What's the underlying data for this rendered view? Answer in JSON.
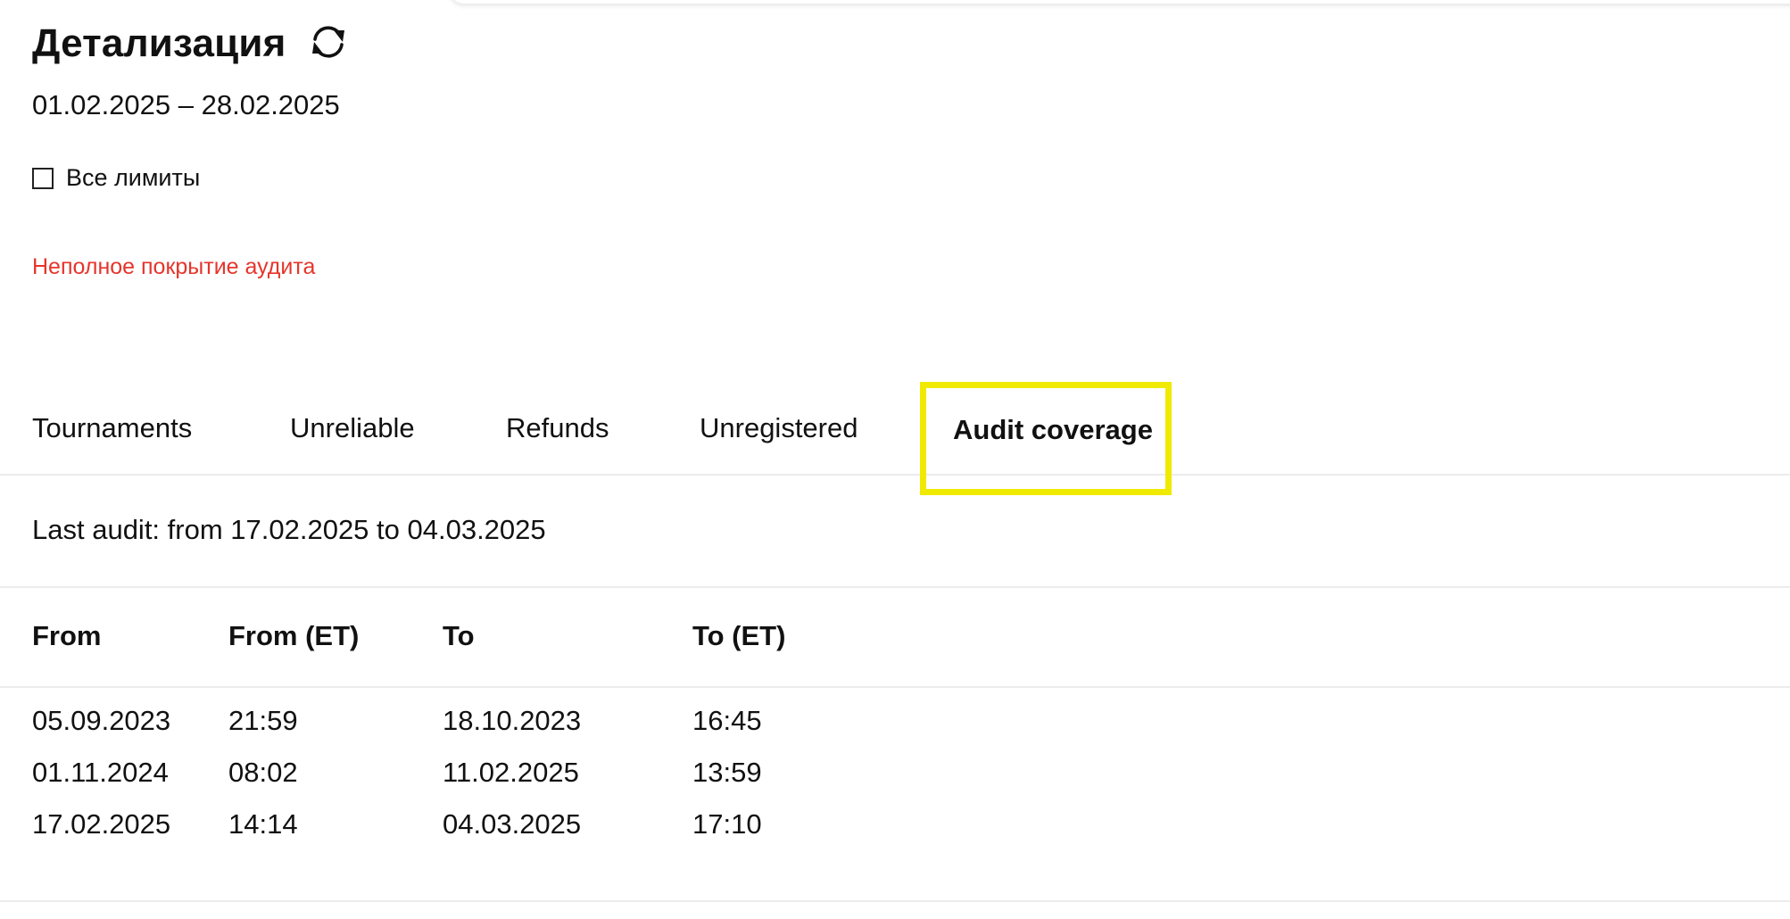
{
  "header": {
    "title": "Детализация",
    "refresh_icon": "refresh-icon"
  },
  "date_range": "01.02.2025 – 28.02.2025",
  "all_limits": {
    "label": "Все лимиты",
    "checked": false
  },
  "warning": {
    "text": "Неполное покрытие аудита",
    "color": "#e5352b"
  },
  "tabs": [
    {
      "label": "Tournaments",
      "active": false
    },
    {
      "label": "Unreliable",
      "active": false
    },
    {
      "label": "Refunds",
      "active": false
    },
    {
      "label": "Unregistered",
      "active": false
    },
    {
      "label": "Audit coverage",
      "active": true
    }
  ],
  "highlight_color": "#f0ea00",
  "last_audit": "Last audit: from 17.02.2025 to 04.03.2025",
  "table": {
    "columns": [
      "From",
      "From (ET)",
      "To",
      "To (ET)"
    ],
    "rows": [
      {
        "from": "05.09.2023",
        "from_et": "21:59",
        "to": "18.10.2023",
        "to_et": "16:45"
      },
      {
        "from": "01.11.2024",
        "from_et": "08:02",
        "to": "11.02.2025",
        "to_et": "13:59"
      },
      {
        "from": "17.02.2025",
        "from_et": "14:14",
        "to": "04.03.2025",
        "to_et": "17:10"
      }
    ]
  }
}
